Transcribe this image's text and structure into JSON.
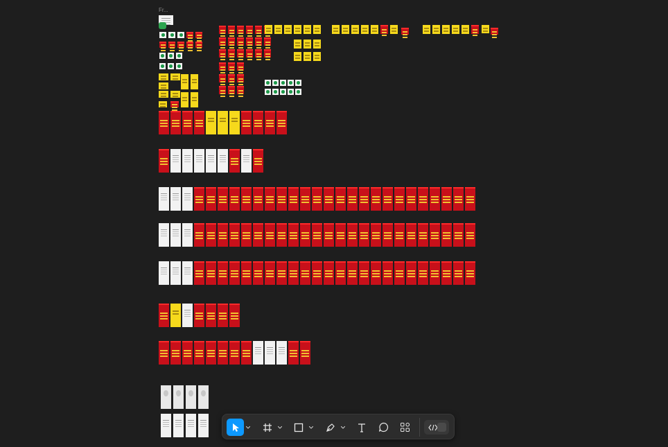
{
  "canvas": {
    "frame_label": "Fr..."
  },
  "colors": {
    "background": "#1e1e1e",
    "red_screen": "#c8101a",
    "yellow_screen": "#f6d91c",
    "accent_blue": "#0d99ff",
    "toolbar_bg": "#2c2c2c"
  },
  "toolbar": {
    "tools": [
      {
        "name": "move-tool",
        "icon": "cursor-arrow-icon",
        "active": true
      },
      {
        "name": "frame-tool",
        "icon": "frame-hash-icon",
        "active": false
      },
      {
        "name": "shape-tool",
        "icon": "rectangle-icon",
        "active": false
      },
      {
        "name": "pen-tool",
        "icon": "pen-icon",
        "active": false
      },
      {
        "name": "text-tool",
        "icon": "text-t-icon",
        "active": false
      },
      {
        "name": "comment-tool",
        "icon": "comment-bubble-icon",
        "active": false
      },
      {
        "name": "actions-tool",
        "icon": "actions-grid-icon",
        "active": false
      }
    ],
    "dev_mode": {
      "icon": "code-brackets-icon",
      "enabled": false
    }
  }
}
